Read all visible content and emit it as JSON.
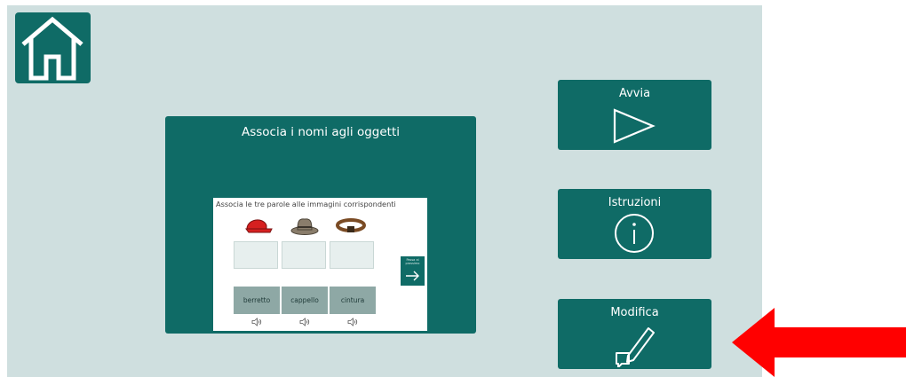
{
  "preview": {
    "title": "Associa i nomi agli oggetti",
    "instruction": "Associa le tre parole alle immagini corrispondenti",
    "words": [
      "berretto",
      "cappello",
      "cintura"
    ],
    "next_label": "Passa al prossimo"
  },
  "actions": {
    "start": "Avvia",
    "instructions": "Istruzioni",
    "edit": "Modifica"
  },
  "icons": {
    "home": "home-icon",
    "start": "play-icon",
    "instructions": "info-icon",
    "edit": "pencil-icon",
    "annotation": "red-arrow"
  },
  "colors": {
    "background": "#cfdfdf",
    "primary": "#0f6b66",
    "accent": "#ff0000"
  }
}
